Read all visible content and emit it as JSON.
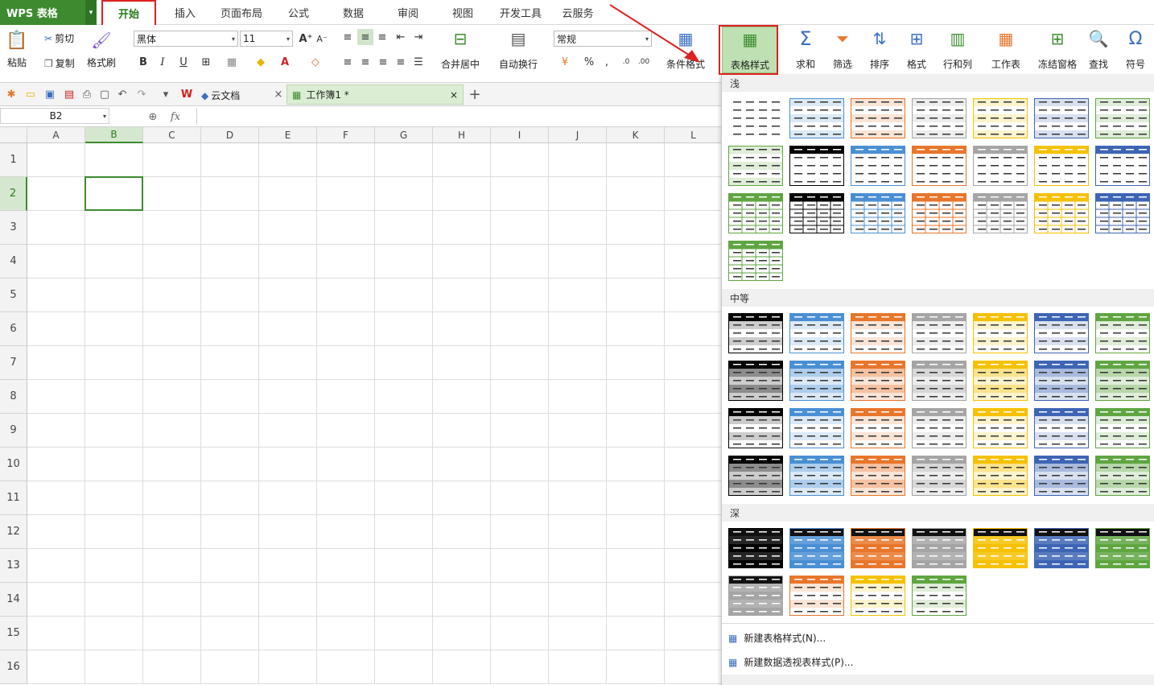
{
  "app": {
    "logo": "WPS 表格"
  },
  "tabs": [
    {
      "label": "开始",
      "active": true
    },
    {
      "label": "插入"
    },
    {
      "label": "页面布局"
    },
    {
      "label": "公式"
    },
    {
      "label": "数据"
    },
    {
      "label": "审阅"
    },
    {
      "label": "视图"
    },
    {
      "label": "开发工具"
    },
    {
      "label": "云服务"
    }
  ],
  "clipboard": {
    "paste": "粘贴",
    "cut": "剪切",
    "copy": "复制",
    "format_painter": "格式刷"
  },
  "font": {
    "name": "黑体",
    "size": "11"
  },
  "number": {
    "format": "常规"
  },
  "ribbon": {
    "merge_center": "合并居中",
    "wrap_text": "自动换行",
    "conditional_format": "条件格式",
    "table_style": "表格样式",
    "sum": "求和",
    "filter": "筛选",
    "sort": "排序",
    "format": "格式",
    "row_col": "行和列",
    "worksheet": "工作表",
    "freeze": "冻结窗格",
    "find": "查找",
    "symbol": "符号"
  },
  "doc_tabs": {
    "cloud": "云文档",
    "workbook": "工作簿1 *"
  },
  "formula_bar": {
    "name_box": "B2",
    "fx": "fx"
  },
  "grid": {
    "columns": [
      "A",
      "B",
      "C",
      "D",
      "E",
      "F",
      "G",
      "H",
      "I",
      "J",
      "K",
      "L"
    ],
    "rows": [
      "1",
      "2",
      "3",
      "4",
      "5",
      "6",
      "7",
      "8",
      "9",
      "10",
      "11",
      "12",
      "13",
      "14",
      "15",
      "16"
    ],
    "selected_col": "B",
    "selected_row": "2"
  },
  "styles_panel": {
    "sections": {
      "light": "浅",
      "medium": "中等",
      "dark": "深"
    },
    "menu": {
      "new_table_style": "新建表格样式(N)...",
      "new_pivot_style": "新建数据透视表样式(P)..."
    }
  },
  "colors": {
    "accent": "#3c8b2e",
    "highlight": "#e02020",
    "palette": [
      "#000000",
      "#4a8fd4",
      "#e8762b",
      "#a5a5a5",
      "#f5c100",
      "#3d65b4",
      "#5fa641"
    ]
  }
}
